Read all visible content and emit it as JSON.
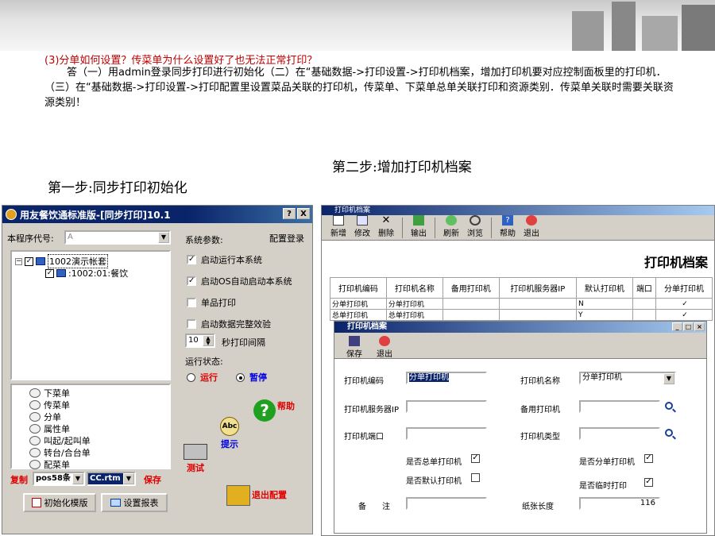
{
  "slide": {
    "question": "(3)分单如何设置？传菜单为什么设置好了也无法正常打印？",
    "answer": "答（一）用admin登录同步打印进行初始化（二）在“基础数据->打印设置->打印机档案，增加打印机要对应控制面板里的打印机．（三）在“基础数据->打印设置->打印配置里设置菜品关联的打印机，传菜单、下菜单总单关联打印和资源类别．传菜单关联时需要关联资源类别！",
    "step2": "第二步:增加打印机档案",
    "step1": "第一步:同步打印初始化"
  },
  "left_dialog": {
    "title": "用友餐饮通标准版-[同步打印]10.1",
    "title_buttons": [
      "?",
      "X"
    ],
    "program_code_label": "本程序代号:",
    "program_code_value": "A",
    "tree": {
      "root": "1002演示帐套",
      "child": ":1002:01:餐饮"
    },
    "bill_types": [
      "下菜单",
      "传菜单",
      "分单",
      "属性单",
      "叫起/起叫单",
      "转台/合台单",
      "配菜单"
    ],
    "copy_label": "复制",
    "copy_combo": "pos58条",
    "file_combo": "CC.rtm",
    "save_label": "保存",
    "init_button": "初始化模版",
    "report_button": "设置报表",
    "sys_params_label": "系统参数:",
    "config_login": "配置登录",
    "checkboxes": [
      {
        "label": "启动运行本系统",
        "checked": true
      },
      {
        "label": "启动OS自动启动本系统",
        "checked": true
      },
      {
        "label": "单品打印",
        "checked": false
      },
      {
        "label": "启动数据完整效验",
        "checked": false
      }
    ],
    "interval_value": "10",
    "interval_label": "秒打印间隔",
    "run_state_label": "运行状态:",
    "radio_run": "运行",
    "radio_pause": "暂停",
    "run_state_selected": "暂停",
    "help_label": "帮助",
    "tip_label": "提示",
    "test_label": "测试",
    "exit_config": "退出配置"
  },
  "printer_archive": {
    "title": "打印机档案",
    "toolbar": [
      "新增",
      "修改",
      "删除",
      "输出",
      "刷新",
      "浏览",
      "帮助",
      "退出"
    ],
    "heading": "打印机档案",
    "columns": [
      "打印机编码",
      "打印机名称",
      "备用打印机",
      "打印机服务器IP",
      "默认打印机",
      "端口",
      "分单打印机"
    ],
    "rows": [
      [
        "分单打印机",
        "分单打印机",
        "",
        "",
        "N",
        "",
        "✓"
      ],
      [
        "总单打印机",
        "总单打印机",
        "",
        "",
        "Y",
        "",
        "✓"
      ]
    ]
  },
  "printer_dialog": {
    "title": "打印机档案",
    "toolbar": [
      "保存",
      "退出"
    ],
    "code_label": "打印机编码",
    "code_value": "分单打印机",
    "name_label": "打印机名称",
    "name_value": "分单打印机",
    "server_ip_label": "打印机服务器IP",
    "backup_label": "备用打印机",
    "port_label": "打印机端口",
    "type_label": "打印机类型",
    "is_total_label": "是否总单打印机",
    "is_split_label": "是否分单打印机",
    "is_default_label": "是否默认打印机",
    "is_temp_label": "是否临时打印",
    "remark_label": "备　　注",
    "paper_label": "纸张长度",
    "paper_value": "116"
  }
}
